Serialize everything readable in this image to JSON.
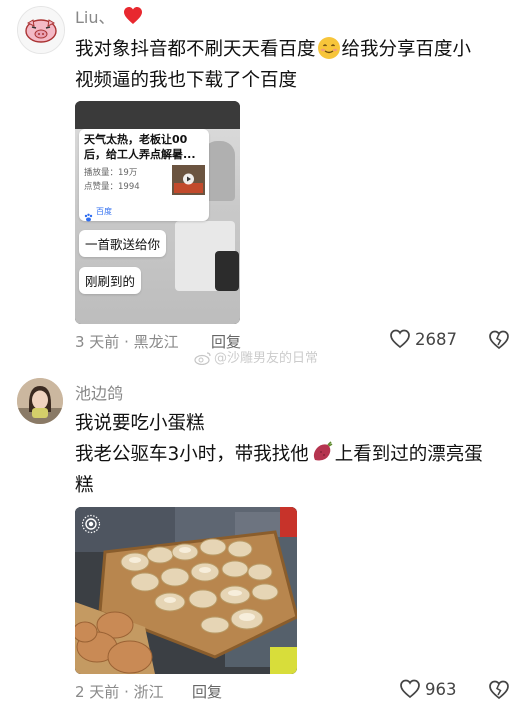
{
  "comments": [
    {
      "username": "Liu、",
      "heart_emoji": "❤️",
      "text_line1": "我对象抖音都不刷天天看百度",
      "text_line1_tail": "给我分享百度小",
      "text_line2": "视频逼的我也下载了个百度",
      "embedded": {
        "card_title": "天气太热，老板让00后，给工人弄点解暑...",
        "play_label": "播放量：19万",
        "like_label": "点赞量：1994",
        "brand": "百度",
        "caption1": "一首歌送给你",
        "caption2": "刚刷到的"
      },
      "meta": "3 天前 · 黑龙江",
      "reply": "回复",
      "likes": "2687"
    },
    {
      "username": "池边鸽",
      "text_line1": "我说要吃小蛋糕",
      "text_line2": "我老公驱车3小时，带我找他",
      "text_line2_tail": "上看到过的漂亮蛋",
      "text_line3": "糕",
      "meta": "2 天前 · 浙江",
      "reply": "回复",
      "likes": "963"
    }
  ],
  "watermark": "@沙雕男友的日常",
  "icons": {
    "like": "heart-outline-icon",
    "dislike": "broken-heart-icon",
    "emoji": "smile-emoji-icon",
    "sweet_potato": "sweet-potato-emoji-icon",
    "weibo": "weibo-logo-icon",
    "live_photo": "live-photo-icon"
  },
  "colors": {
    "heart": "#e8282f",
    "sweet_potato": "#b5344f",
    "meta_gray": "#8a8a8a"
  }
}
